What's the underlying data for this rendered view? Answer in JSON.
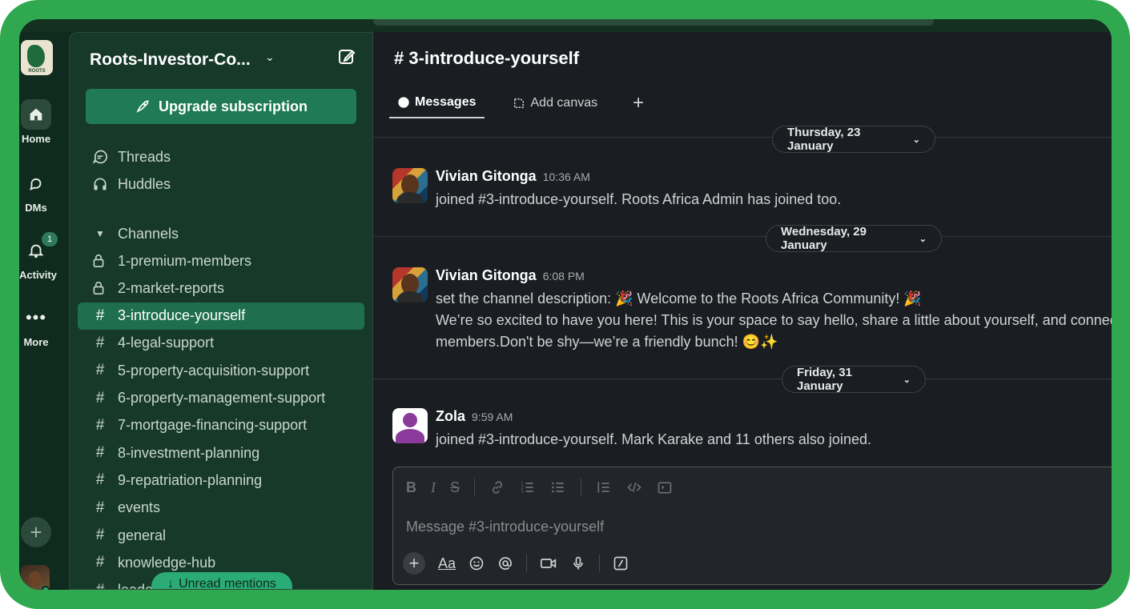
{
  "workspace": {
    "name": "Roots-Investor-Co...",
    "logo_text": "ROOTS",
    "upgrade_label": "Upgrade subscription"
  },
  "rail": {
    "items": [
      {
        "label": "Home",
        "icon": "home-icon"
      },
      {
        "label": "DMs",
        "icon": "dms-icon"
      },
      {
        "label": "Activity",
        "icon": "bell-icon",
        "badge": "1"
      },
      {
        "label": "More",
        "icon": "ellipsis-icon"
      }
    ]
  },
  "sidebar": {
    "top_items": [
      {
        "label": "Threads",
        "icon": "threads-icon"
      },
      {
        "label": "Huddles",
        "icon": "headphones-icon"
      }
    ],
    "channels_header": "Channels",
    "channels": [
      {
        "label": "1-premium-members",
        "private": true
      },
      {
        "label": "2-market-reports",
        "private": true
      },
      {
        "label": "3-introduce-yourself",
        "active": true
      },
      {
        "label": "4-legal-support"
      },
      {
        "label": "5-property-acquisition-support"
      },
      {
        "label": "6-property-management-support"
      },
      {
        "label": "7-mortgage-financing-support"
      },
      {
        "label": "8-investment-planning"
      },
      {
        "label": "9-repatriation-planning"
      },
      {
        "label": "events"
      },
      {
        "label": "general"
      },
      {
        "label": "knowledge-hub"
      },
      {
        "label": "leade"
      }
    ],
    "unread_mentions": "Unread mentions"
  },
  "channel": {
    "title": "# 3-introduce-yourself",
    "tabs": [
      {
        "label": "Messages",
        "active": true
      },
      {
        "label": "Add canvas"
      }
    ]
  },
  "dates": [
    "Thursday, 23 January",
    "Wednesday, 29 January",
    "Friday, 31 January"
  ],
  "messages": [
    {
      "author": "Vivian Gitonga",
      "time": "10:36 AM",
      "lines": [
        "joined #3-introduce-yourself. Roots Africa Admin has joined too."
      ]
    },
    {
      "author": "Vivian Gitonga",
      "time": "6:08 PM",
      "lines": [
        "set the channel description: 🎉 Welcome to the Roots Africa Community! 🎉",
        "We’re so excited to have you here! This is your space to say hello, share a little about yourself, and connec",
        "members.Don't be shy—we’re a friendly bunch! 😊✨"
      ]
    },
    {
      "author": "Zola",
      "time": "9:59 AM",
      "lines": [
        "joined #3-introduce-yourself. Mark Karake and 11 others also joined."
      ]
    }
  ],
  "composer": {
    "placeholder": "Message #3-introduce-yourself"
  },
  "colors": {
    "frame": "#2fa84f",
    "sidebar": "#16392a",
    "active_channel": "#1f6f4f",
    "upgrade_button": "#1f7a55",
    "main_bg": "#1a1d21"
  }
}
